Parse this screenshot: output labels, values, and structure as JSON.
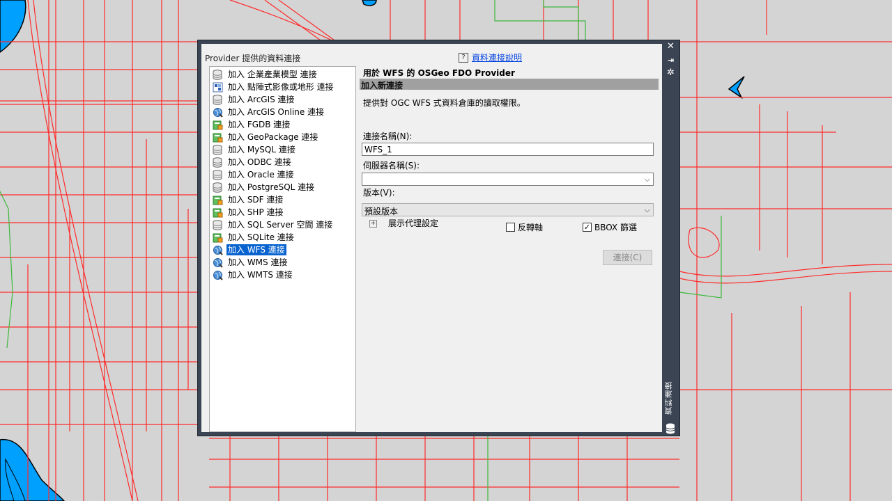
{
  "palette": {
    "side_title": "資料連接",
    "provider_label": "Provider 提供的資料連接",
    "help_link": "資料連接說明",
    "help_icon": "?",
    "providers": [
      {
        "label": "加入 企業產業模型 連接",
        "icon": "database-icon",
        "selected": false
      },
      {
        "label": "加入 點陣式影像或地形 連接",
        "icon": "raster-icon",
        "selected": false
      },
      {
        "label": "加入 ArcGIS 連接",
        "icon": "database-icon",
        "selected": false
      },
      {
        "label": "加入 ArcGIS Online 連接",
        "icon": "globe-icon",
        "selected": false
      },
      {
        "label": "加入 FGDB 連接",
        "icon": "file-db-icon",
        "selected": false
      },
      {
        "label": "加入 GeoPackage 連接",
        "icon": "file-db-icon",
        "selected": false
      },
      {
        "label": "加入 MySQL 連接",
        "icon": "database-icon",
        "selected": false
      },
      {
        "label": "加入 ODBC 連接",
        "icon": "database-icon",
        "selected": false
      },
      {
        "label": "加入 Oracle 連接",
        "icon": "database-icon",
        "selected": false
      },
      {
        "label": "加入 PostgreSQL 連接",
        "icon": "database-icon",
        "selected": false
      },
      {
        "label": "加入 SDF 連接",
        "icon": "file-db-icon",
        "selected": false
      },
      {
        "label": "加入 SHP 連接",
        "icon": "file-db-icon",
        "selected": false
      },
      {
        "label": "加入 SQL Server 空間 連接",
        "icon": "database-icon",
        "selected": false
      },
      {
        "label": "加入 SQLite 連接",
        "icon": "file-db-icon",
        "selected": false
      },
      {
        "label": "加入 WFS 連接",
        "icon": "globe-icon",
        "selected": true
      },
      {
        "label": "加入 WMS 連接",
        "icon": "globe-icon",
        "selected": false
      },
      {
        "label": "加入 WMTS 連接",
        "icon": "globe-icon",
        "selected": false
      }
    ],
    "panel": {
      "title": "用於 WFS 的 OSGeo FDO Provider",
      "section": "加入新連接",
      "description": "提供對 OGC WFS 式資料倉庫的讀取權限。",
      "conn_name_label": "連接名稱(N):",
      "conn_name_value": "WFS_1",
      "server_label": "伺服器名稱(S):",
      "server_value": "",
      "version_label": "版本(V):",
      "version_value": "預設版本",
      "proxy_label": "展示代理設定",
      "invert_axis_label": "反轉軸",
      "invert_axis_checked": false,
      "bbox_label": "BBOX 篩選",
      "bbox_checked": true,
      "connect_button": "連接(C)"
    }
  }
}
